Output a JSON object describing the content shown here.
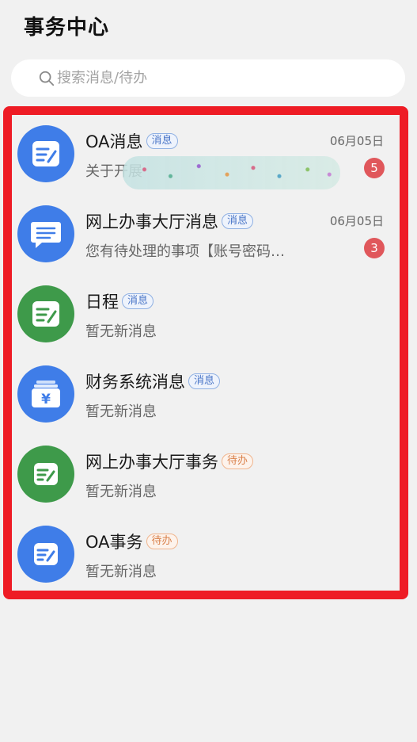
{
  "header": {
    "title": "事务中心"
  },
  "search": {
    "placeholder": "搜索消息/待办"
  },
  "items": [
    {
      "title": "OA消息",
      "tag": "消息",
      "tag_type": "msg",
      "date": "06月05日",
      "subtitle": "关于开展",
      "badge": "5",
      "icon": "document-pen-icon",
      "color": "#3f7de8",
      "obscured": true
    },
    {
      "title": "网上办事大厅消息",
      "tag": "消息",
      "tag_type": "msg",
      "date": "06月05日",
      "subtitle": "您有待处理的事项【账号密码…",
      "badge": "3",
      "icon": "chat-bubble-icon",
      "color": "#3f7de8"
    },
    {
      "title": "日程",
      "tag": "消息",
      "tag_type": "msg",
      "date": "",
      "subtitle": "暂无新消息",
      "badge": "",
      "icon": "document-pen-icon",
      "color": "#3e9a4a"
    },
    {
      "title": "财务系统消息",
      "tag": "消息",
      "tag_type": "msg",
      "date": "",
      "subtitle": "暂无新消息",
      "badge": "",
      "icon": "wallet-yen-icon",
      "color": "#3f7de8"
    },
    {
      "title": "网上办事大厅事务",
      "tag": "待办",
      "tag_type": "todo",
      "date": "",
      "subtitle": "暂无新消息",
      "badge": "",
      "icon": "document-pen-icon",
      "color": "#3e9a4a"
    },
    {
      "title": "OA事务",
      "tag": "待办",
      "tag_type": "todo",
      "date": "",
      "subtitle": "暂无新消息",
      "badge": "",
      "icon": "document-pen-icon",
      "color": "#3f7de8"
    }
  ]
}
